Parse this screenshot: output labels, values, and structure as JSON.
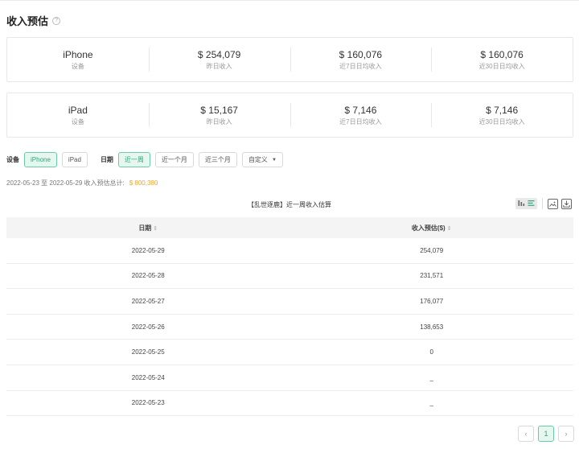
{
  "page": {
    "title": "收入预估"
  },
  "cards": [
    {
      "device": "iPhone",
      "device_label": "设备",
      "stats": [
        {
          "value": "$ 254,079",
          "label": "昨日收入"
        },
        {
          "value": "$ 160,076",
          "label": "近7日日均收入"
        },
        {
          "value": "$ 160,076",
          "label": "近30日日均收入"
        }
      ]
    },
    {
      "device": "iPad",
      "device_label": "设备",
      "stats": [
        {
          "value": "$ 15,167",
          "label": "昨日收入"
        },
        {
          "value": "$ 7,146",
          "label": "近7日日均收入"
        },
        {
          "value": "$ 7,146",
          "label": "近30日日均收入"
        }
      ]
    }
  ],
  "filters": {
    "device_label": "设备",
    "devices": [
      "iPhone",
      "iPad"
    ],
    "device_selected": "iPhone",
    "date_label": "日期",
    "ranges": [
      "近一周",
      "近一个月",
      "近三个月"
    ],
    "range_selected": "近一周",
    "custom": "自定义"
  },
  "summary": {
    "text": "2022-05-23 至 2022-05-29 收入预估总计:",
    "total": "$ 800,380"
  },
  "table": {
    "title": "【乱世逐鹿】近一周收入估算",
    "columns": [
      "日期",
      "收入预估($)"
    ],
    "sort_glyph": "⇕",
    "rows": [
      [
        "2022-05-29",
        "254,079"
      ],
      [
        "2022-05-28",
        "231,571"
      ],
      [
        "2022-05-27",
        "176,077"
      ],
      [
        "2022-05-26",
        "138,653"
      ],
      [
        "2022-05-25",
        "0"
      ],
      [
        "2022-05-24",
        "_"
      ],
      [
        "2022-05-23",
        "_"
      ]
    ]
  },
  "pagination": {
    "prev": "‹",
    "current": "1",
    "next": "›"
  },
  "colors": {
    "accent": "#2fa57c",
    "accent_bg": "#e6f7f0",
    "total": "#e8a530"
  },
  "icons": [
    "help-icon",
    "bar-chart-icon",
    "list-icon",
    "image-download-icon",
    "download-icon",
    "chevron-down-icon"
  ]
}
